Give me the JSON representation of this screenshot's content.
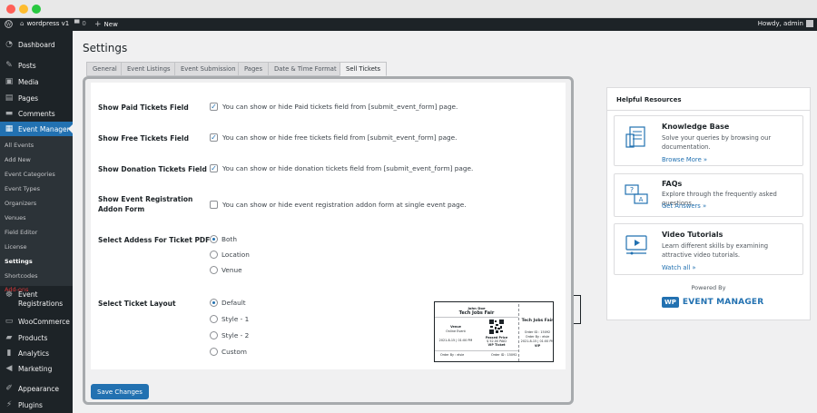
{
  "adminbar": {
    "site_name": "wordpress v1",
    "comments_count": "0",
    "new_label": "New",
    "howdy": "Howdy, admin"
  },
  "sidebar": {
    "items": [
      {
        "label": "Dashboard"
      },
      {
        "label": "Posts"
      },
      {
        "label": "Media"
      },
      {
        "label": "Pages"
      },
      {
        "label": "Comments"
      },
      {
        "label": "Event Manager"
      },
      {
        "label": "Event"
      },
      {
        "label": "Registrations"
      },
      {
        "label": "WooCommerce"
      },
      {
        "label": "Products"
      },
      {
        "label": "Analytics"
      },
      {
        "label": "Marketing"
      },
      {
        "label": "Appearance"
      },
      {
        "label": "Plugins"
      }
    ],
    "submenu": [
      "All Events",
      "Add New",
      "Event Categories",
      "Event Types",
      "Organizers",
      "Venues",
      "Field Editor",
      "License",
      "Settings",
      "Shortcodes",
      "Add-ons"
    ]
  },
  "page": {
    "title": "Settings"
  },
  "tabs": [
    "General",
    "Event Listings",
    "Event Submission",
    "Pages",
    "Date & Time Format",
    "Sell Tickets"
  ],
  "settings": {
    "paid": {
      "label": "Show Paid Tickets Field",
      "desc": "You can show or hide Paid tickets field from [submit_event_form] page."
    },
    "free": {
      "label": "Show Free Tickets Field",
      "desc": "You can show or hide free tickets field from [submit_event_form] page."
    },
    "donation": {
      "label": "Show Donation Tickets Field",
      "desc": "You can show or hide donation tickets field from [submit_event_form] page."
    },
    "registration": {
      "label_line1": "Show Event Registration",
      "label_line2": "Addon Form",
      "desc": "You can show or hide event registration addon form at single event page."
    },
    "address": {
      "label": "Select Addess For Ticket PDF",
      "options": [
        "Both",
        "Location",
        "Venue"
      ]
    },
    "layout": {
      "label": "Select Ticket Layout",
      "options": [
        "Default",
        "Style - 1",
        "Style - 2",
        "Custom"
      ]
    }
  },
  "ticket": {
    "name": "John Doe",
    "event": "Tech Jobs Fair",
    "venue_label": "Venue",
    "venue": "Online Event",
    "date": "2021-8-15 | 01:00 PM",
    "passed_price": "Passed Price",
    "price": "$ 52.00 PAID",
    "ticket_type": "VIP Ticket",
    "order_by": "Order By : elsie",
    "order_id": "Order ID : 15092",
    "right_event": "Tech Jobs Fair",
    "right_order_id": "Order ID : 15092",
    "right_order_by": "Order By : elsie",
    "right_date": "2021-8-15 | 01:00 PM",
    "right_type": "VIP"
  },
  "save_label": "Save Changes",
  "resources": {
    "title": "Helpful Resources",
    "cards": [
      {
        "title": "Knowledge Base",
        "desc": "Solve your queries by browsing our documentation.",
        "link": "Browse More »"
      },
      {
        "title": "FAQs",
        "desc": "Explore through the frequently asked questions.",
        "link": "Get Answers »"
      },
      {
        "title": "Video Tutorials",
        "desc": "Learn different skills by examining attractive video tutorials.",
        "link": "Watch all »"
      }
    ],
    "powered_by": "Powered By",
    "logo_text": "EVENT MANAGER",
    "logo_badge": "WP"
  },
  "colors": {
    "accent": "#2271b1",
    "admin_bar": "#1d2327",
    "active_menu": "#2271b1",
    "addons": "#d63638"
  }
}
